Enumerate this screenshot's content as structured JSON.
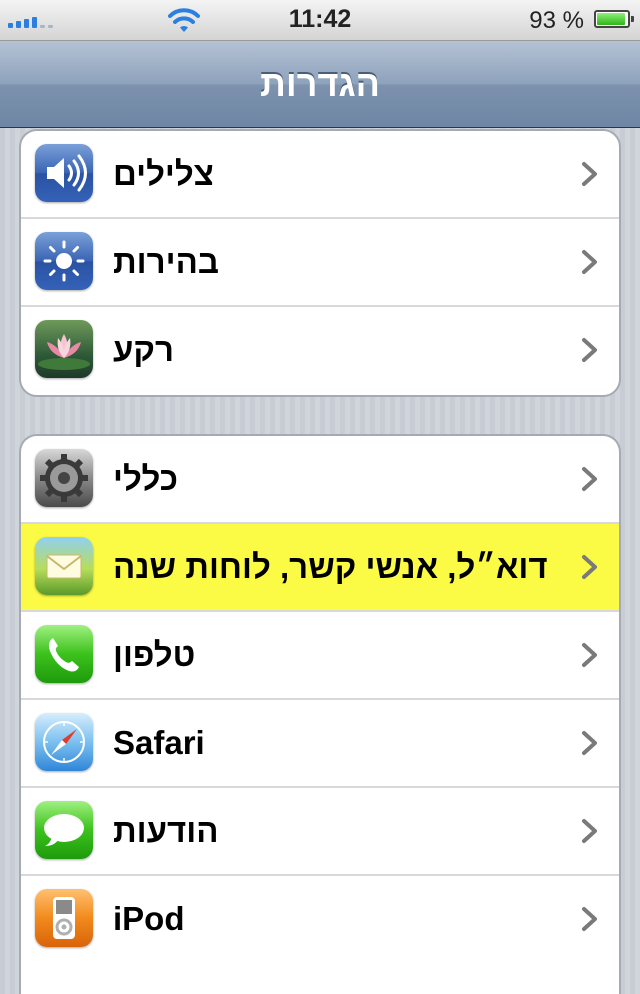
{
  "status_bar": {
    "time": "11:42",
    "battery_percent": "93 %",
    "battery_level": 0.93,
    "signal_icon": "signal-bars-icon",
    "wifi_icon": "wifi-icon"
  },
  "nav": {
    "title": "הגדרות"
  },
  "groups": [
    {
      "items": [
        {
          "label": "צלילים",
          "icon": "speaker-icon"
        },
        {
          "label": "בהירות",
          "icon": "brightness-icon"
        },
        {
          "label": "רקע",
          "icon": "wallpaper-lotus-icon"
        }
      ]
    },
    {
      "items": [
        {
          "label": "כללי",
          "icon": "gear-icon"
        },
        {
          "label": "דוא״ל, אנשי קשר, לוחות שנה",
          "icon": "mail-icon",
          "highlighted": true
        },
        {
          "label": "טלפון",
          "icon": "phone-icon"
        },
        {
          "label": "Safari",
          "icon": "safari-compass-icon"
        },
        {
          "label": "הודעות",
          "icon": "messages-icon"
        },
        {
          "label": "iPod",
          "icon": "ipod-icon"
        }
      ]
    }
  ],
  "colors": {
    "highlight": "#fbfa45",
    "nav_bar": "#8ea2bc",
    "signal": "#2a7fe0"
  }
}
